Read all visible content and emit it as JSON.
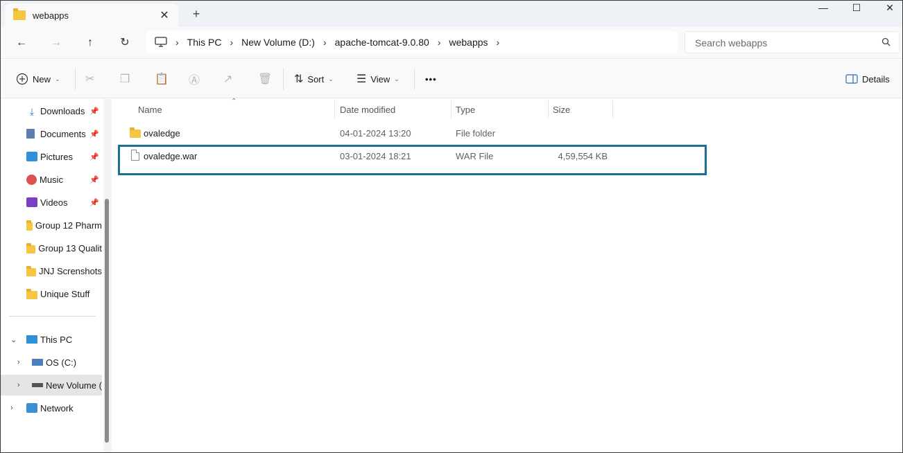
{
  "window": {
    "tab_title": "webapps",
    "new_tab_glyph": "+",
    "tab_close_glyph": "✕",
    "minimize_glyph": "—",
    "maximize_glyph": "☐",
    "close_glyph": "✕"
  },
  "nav": {
    "back_icon": "←",
    "forward_icon": "→",
    "up_icon": "↑",
    "refresh_icon": "↻",
    "separator": "›"
  },
  "breadcrumb": [
    "This PC",
    "New Volume (D:)",
    "apache-tomcat-9.0.80",
    "webapps"
  ],
  "search": {
    "placeholder": "Search webapps",
    "icon": "search-icon"
  },
  "commands": {
    "new_label": "New",
    "sort_label": "Sort",
    "view_label": "View",
    "more_label": "•••",
    "details_label": "Details"
  },
  "sidebar": {
    "quick_access": [
      {
        "label": "Downloads",
        "icon": "download-icon",
        "pinned": true
      },
      {
        "label": "Documents",
        "icon": "documents-icon",
        "pinned": true
      },
      {
        "label": "Pictures",
        "icon": "pictures-icon",
        "pinned": true
      },
      {
        "label": "Music",
        "icon": "music-icon",
        "pinned": true
      },
      {
        "label": "Videos",
        "icon": "videos-icon",
        "pinned": true
      },
      {
        "label": "Group 12 Pharm",
        "icon": "folder-icon",
        "pinned": false
      },
      {
        "label": "Group 13 Qualit",
        "icon": "folder-icon",
        "pinned": false
      },
      {
        "label": "JNJ Screnshots",
        "icon": "folder-icon",
        "pinned": false
      },
      {
        "label": "Unique Stuff",
        "icon": "folder-icon",
        "pinned": false
      }
    ],
    "this_pc": "This PC",
    "drives": [
      {
        "label": "OS (C:)"
      },
      {
        "label": "New Volume (D"
      }
    ],
    "network": "Network",
    "pin_glyph": "📌"
  },
  "columns": {
    "name": "Name",
    "date": "Date modified",
    "type": "Type",
    "size": "Size"
  },
  "files": [
    {
      "name": "ovaledge",
      "date": "04-01-2024 13:20",
      "type": "File folder",
      "size": "",
      "icon": "folder-icon"
    },
    {
      "name": "ovaledge.war",
      "date": "03-01-2024 18:21",
      "type": "WAR File",
      "size": "4,59,554 KB",
      "icon": "file-icon",
      "highlighted": true
    }
  ],
  "colors": {
    "highlight_border": "#1a6f92",
    "folder": "#f4c642"
  }
}
